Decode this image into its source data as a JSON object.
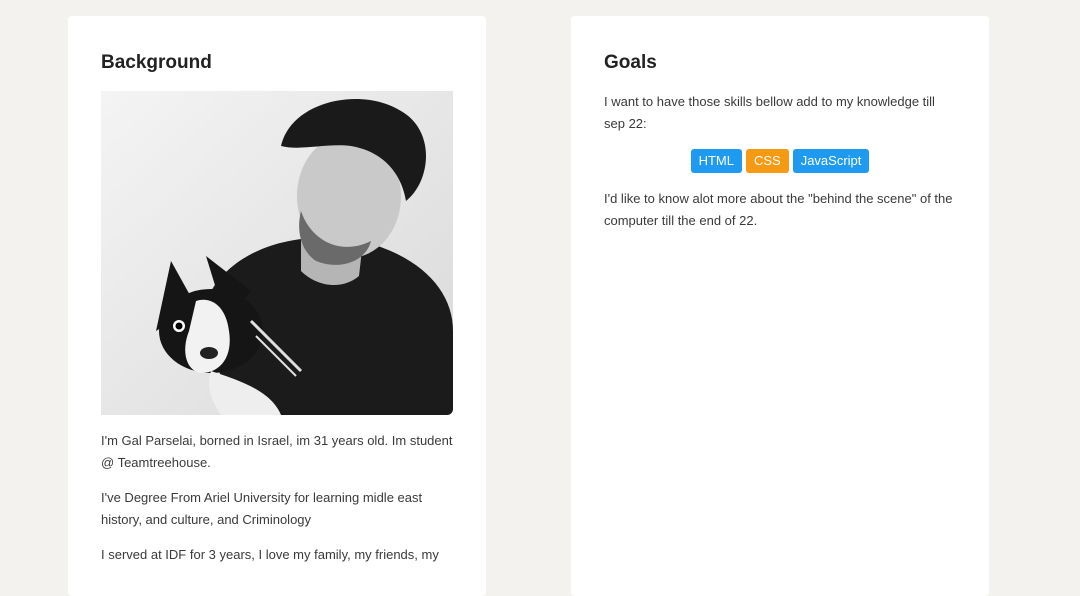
{
  "background": {
    "title": "Background",
    "photo_alt": "Gal Parselai holding a dog",
    "paragraphs": [
      "I'm Gal Parselai, borned in Israel, im 31 years old. Im student @ Teamtreehouse.",
      "I've Degree From Ariel University for learning midle east history, and culture, and Criminology",
      "I served at IDF for 3 years, I love my family, my friends, my"
    ]
  },
  "goals": {
    "title": "Goals",
    "intro": "I want to have those skills bellow add to my knowledge till sep 22:",
    "tags": [
      {
        "label": "HTML",
        "color": "#1e9bf0"
      },
      {
        "label": "CSS",
        "color": "#f59a12"
      },
      {
        "label": "JavaScript",
        "color": "#1e9bf0"
      }
    ],
    "more": "I'd like to know alot more about the \"behind the scene\" of the computer till the end of 22."
  }
}
